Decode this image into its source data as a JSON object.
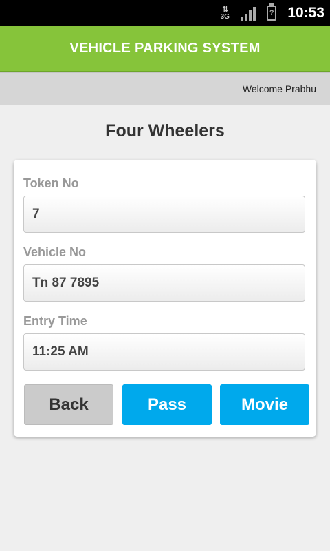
{
  "status_bar": {
    "network_label": "3G",
    "network_arrows": "⇅",
    "battery_glyph": "?",
    "time": "10:53"
  },
  "header": {
    "title": "VEHICLE PARKING SYSTEM",
    "color": "#86c43a"
  },
  "welcome": {
    "text": "Welcome Prabhu"
  },
  "page": {
    "title": "Four Wheelers"
  },
  "form": {
    "fields": [
      {
        "label": "Token No",
        "value": "7"
      },
      {
        "label": "Vehicle No",
        "value": "Tn 87 7895"
      },
      {
        "label": "Entry Time",
        "value": "11:25 AM"
      }
    ],
    "buttons": {
      "back": "Back",
      "pass": "Pass",
      "movie": "Movie"
    },
    "accent_color": "#00a9ec"
  }
}
